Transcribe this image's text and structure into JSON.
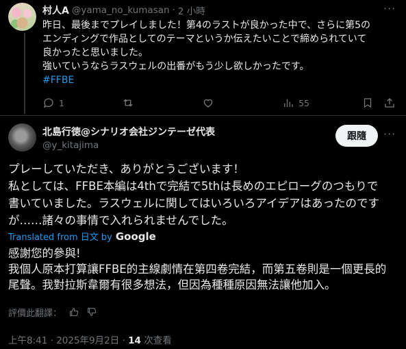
{
  "reply": {
    "name": "村人A",
    "handle": "@yama_no_kumasan",
    "separator": "·",
    "time": "2 小時",
    "more": "···",
    "lines": [
      "昨日、最後までプレイしました！第4のラストが良かった中で、さらに第5の",
      "エンディングで作品としてのテーマというか伝えたいことで締められていて",
      "良かったと思いました。",
      "強いていうならラスウェルの出番がもう少し欲しかったです。"
    ],
    "hashtag": "#FFBE",
    "actions": {
      "reply_count": "1",
      "repost_count": "",
      "like_count": "",
      "view_count": "55"
    }
  },
  "tweet": {
    "name": "北島行徳@シナリオ会社ジンテーゼ代表",
    "handle": "@y_kitajima",
    "follow_label": "跟隨",
    "more": "···",
    "lines": [
      "プレーしていただき、ありがとうございます！",
      "私としては、FFBE本編は4thで完結で5thは長めのエピローグのつもりで",
      "書いていました。ラスウェルに関してはいろいろアイデアはあったのです",
      "が……諸々の事情で入れられませんでした。"
    ],
    "translated_from": "Translated from 日文 by",
    "translator": "Google",
    "translation_lines": [
      "感謝您的參與!",
      "我個人原本打算讓FFBE的主線劇情在第四卷完結，而第五卷則是一個更長的",
      "尾聲。我對拉斯韋爾有很多想法，但因為種種原因無法讓他加入。"
    ],
    "rate_label": "評價此翻譯：",
    "date_time": "上午8:41 · 2025年9月2日 · ",
    "view_count": "14",
    "view_label": " 次查看"
  },
  "colors": {
    "background": "#000000",
    "text": "#e7e9ea",
    "muted": "#71767b",
    "link": "#1d9bf0",
    "divider": "#2f3336"
  }
}
